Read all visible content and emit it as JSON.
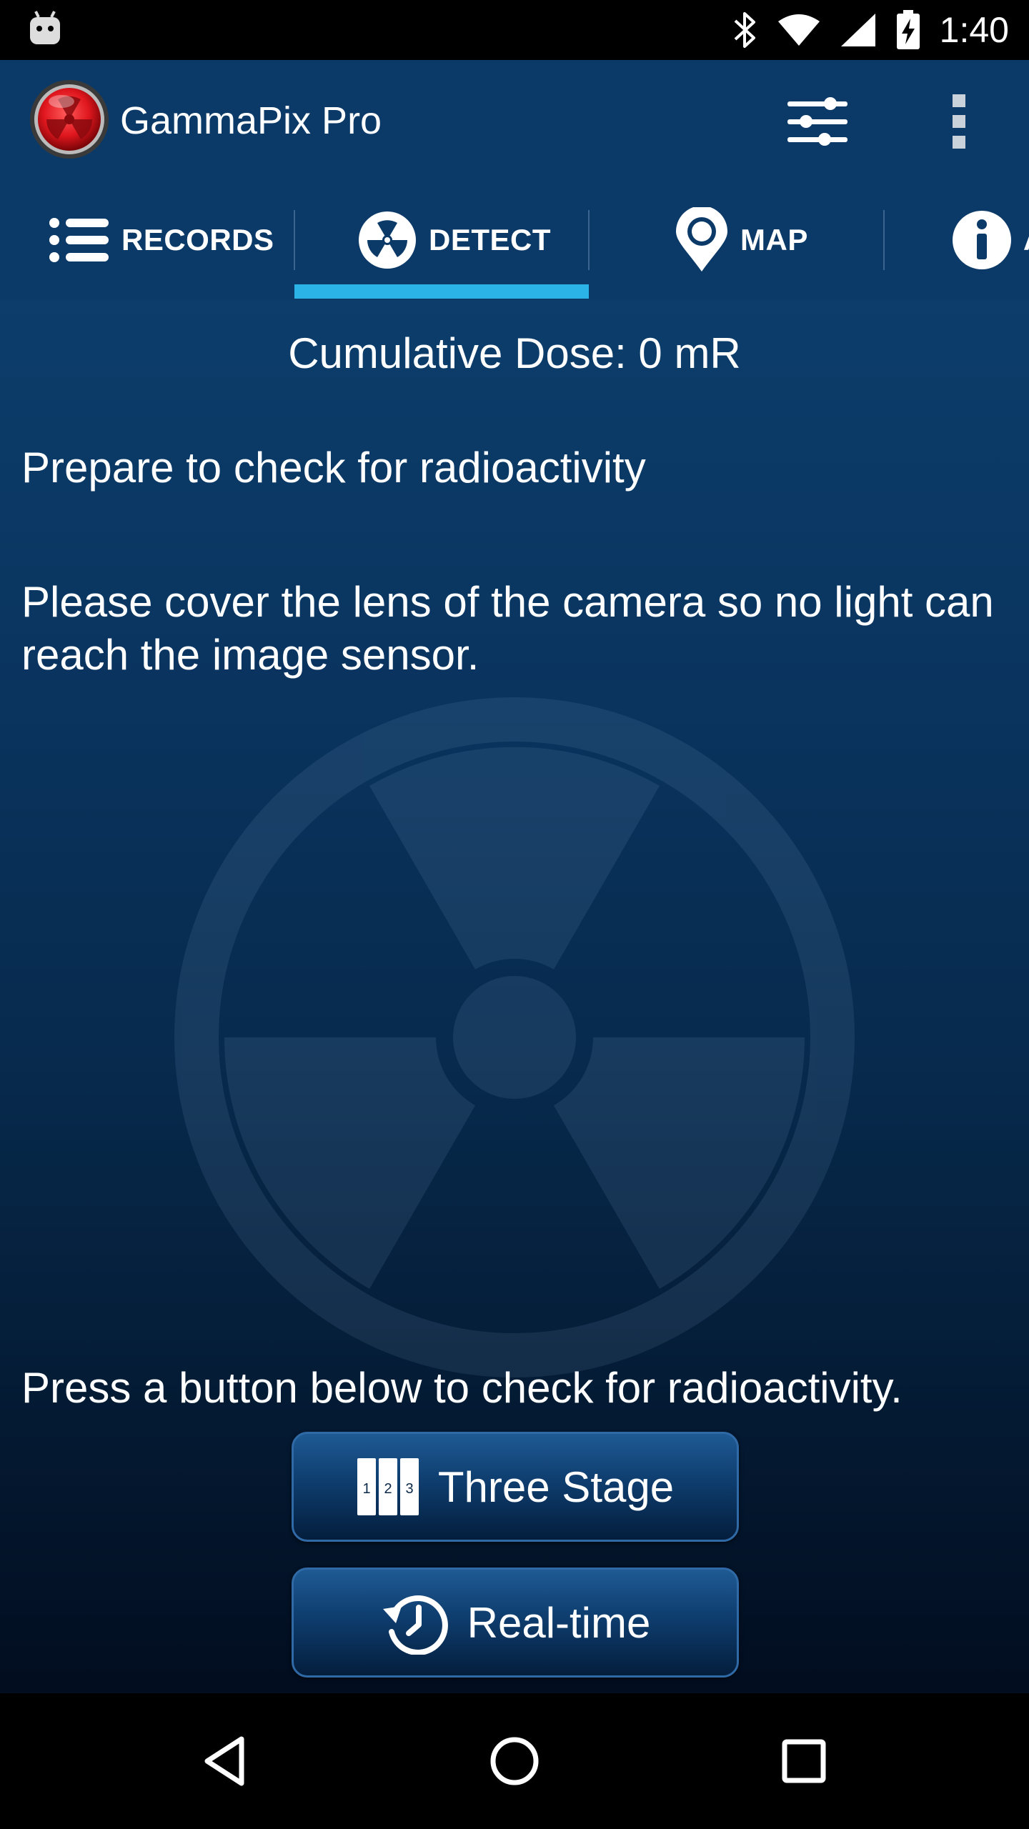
{
  "status_bar": {
    "time": "1:40",
    "icons": [
      "android-icon",
      "bluetooth-icon",
      "wifi-icon",
      "cellular-signal-icon",
      "battery-charging-icon"
    ]
  },
  "app_bar": {
    "title": "GammaPix Pro",
    "logo_icon": "gammapix-logo-icon",
    "actions": [
      "filter-settings-icon",
      "more-vert-icon"
    ]
  },
  "tabs": [
    {
      "label": "RECORDS",
      "icon": "list-icon",
      "selected": false
    },
    {
      "label": "DETECT",
      "icon": "radiation-icon",
      "selected": true
    },
    {
      "label": "MAP",
      "icon": "map-pin-icon",
      "selected": false
    },
    {
      "label": "A",
      "icon": "info-icon",
      "selected": false
    }
  ],
  "content": {
    "cumulative_dose": "Cumulative Dose:  0 mR",
    "prepare_text": "Prepare to check for radioactivity",
    "instruction_text": "Please cover the lens of the camera so no light can reach the image sensor.",
    "press_text": "Press a button below to check for radioactivity."
  },
  "buttons": {
    "three_stage_label": "Three Stage",
    "three_stage_icon_digits": [
      "1",
      "2",
      "3"
    ],
    "realtime_label": "Real-time"
  },
  "colors": {
    "appbar": "#0b3a68",
    "tab_indicator": "#2bb2e6",
    "logo_red": "#e0161e"
  },
  "nav_bar": [
    "back-icon",
    "home-icon",
    "recents-icon"
  ]
}
